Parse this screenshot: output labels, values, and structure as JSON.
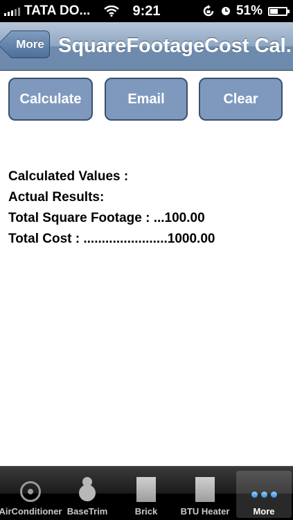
{
  "status_bar": {
    "carrier": "TATA DO...",
    "time": "9:21",
    "battery": "51%",
    "battery_level": 0.51
  },
  "nav": {
    "back_label": "More",
    "title": "SquareFootageCost Cal..."
  },
  "actions": {
    "calculate": "Calculate",
    "email": "Email",
    "clear": "Clear"
  },
  "results": {
    "heading": "Calculated Values :",
    "subheading": "Actual Results:",
    "square_footage": "Total Square Footage : ...100.00",
    "total_cost": "Total Cost : .......................1000.00"
  },
  "tabs": [
    {
      "label": "AirConditioner",
      "icon": "air-conditioner-icon"
    },
    {
      "label": "BaseTrim",
      "icon": "base-trim-icon"
    },
    {
      "label": "Brick",
      "icon": "brick-icon"
    },
    {
      "label": "BTU Heater",
      "icon": "btu-heater-icon"
    },
    {
      "label": "More",
      "icon": "more-icon",
      "selected": true
    }
  ]
}
